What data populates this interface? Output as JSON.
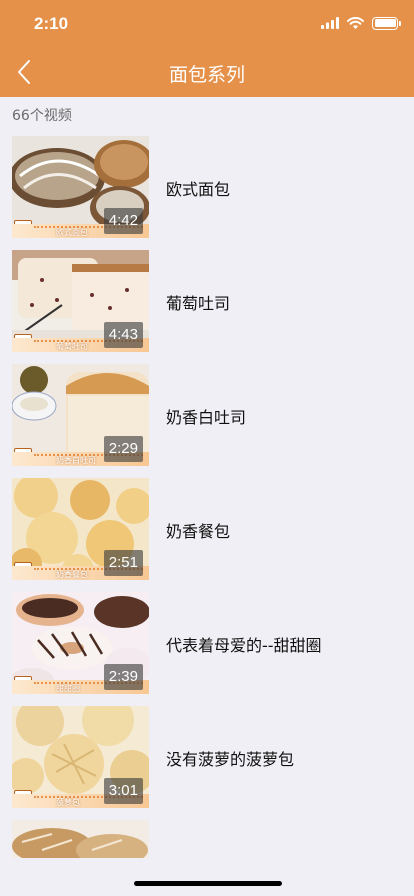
{
  "status": {
    "time": "2:10"
  },
  "nav": {
    "title": "面包系列"
  },
  "count_label": "66个视频",
  "videos": [
    {
      "title": "欧式面包",
      "duration": "4:42",
      "caption": "欧式面包"
    },
    {
      "title": "葡萄吐司",
      "duration": "4:43",
      "caption": "葡萄吐司"
    },
    {
      "title": "奶香白吐司",
      "duration": "2:29",
      "caption": "奶香白吐司"
    },
    {
      "title": "奶香餐包",
      "duration": "2:51",
      "caption": "奶香餐包"
    },
    {
      "title": "代表着母爱的--甜甜圈",
      "duration": "2:39",
      "caption": "甜甜圈"
    },
    {
      "title": "没有菠萝的菠萝包",
      "duration": "3:01",
      "caption": "菠萝包"
    },
    {
      "title": "",
      "duration": "",
      "caption": ""
    }
  ]
}
